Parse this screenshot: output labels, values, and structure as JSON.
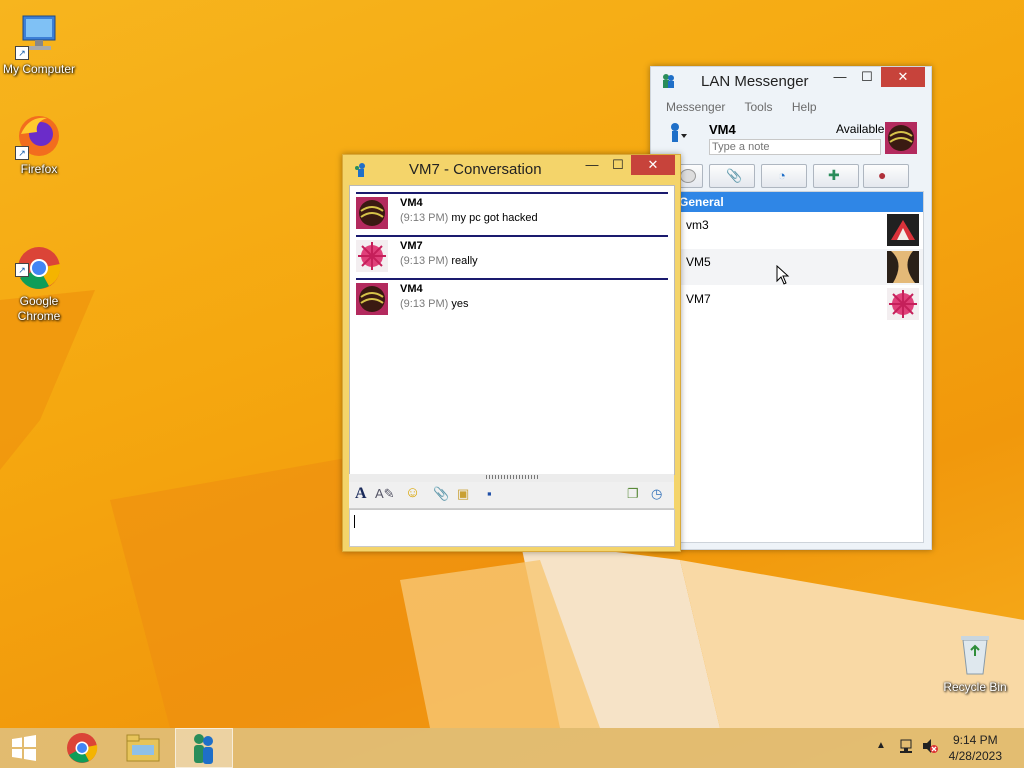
{
  "desktop": {
    "icons": [
      {
        "label": "My Computer"
      },
      {
        "label": "Firefox"
      },
      {
        "label": "Google\nChrome"
      },
      {
        "label": "Recycle Bin"
      }
    ]
  },
  "lan_messenger": {
    "title": "LAN Messenger",
    "menu": [
      "Messenger",
      "Tools",
      "Help"
    ],
    "user": {
      "name": "VM4",
      "status": "Available",
      "note_placeholder": "Type a note"
    },
    "group": "General",
    "contacts": [
      {
        "name": "vm3"
      },
      {
        "name": "VM5"
      },
      {
        "name": "VM7"
      }
    ]
  },
  "conversation": {
    "title": "VM7 - Conversation",
    "messages": [
      {
        "from": "VM4",
        "time": "(9:13 PM)",
        "text": "my pc got hacked"
      },
      {
        "from": "VM7",
        "time": "(9:13 PM)",
        "text": "really"
      },
      {
        "from": "VM4",
        "time": "(9:13 PM)",
        "text": "yes"
      }
    ],
    "input_value": ""
  },
  "taskbar": {
    "time": "9:14 PM",
    "date": "4/28/2023"
  },
  "colors": {
    "accent": "#2f86e6",
    "close": "#c7433b",
    "desktop": "#f5a70f"
  }
}
